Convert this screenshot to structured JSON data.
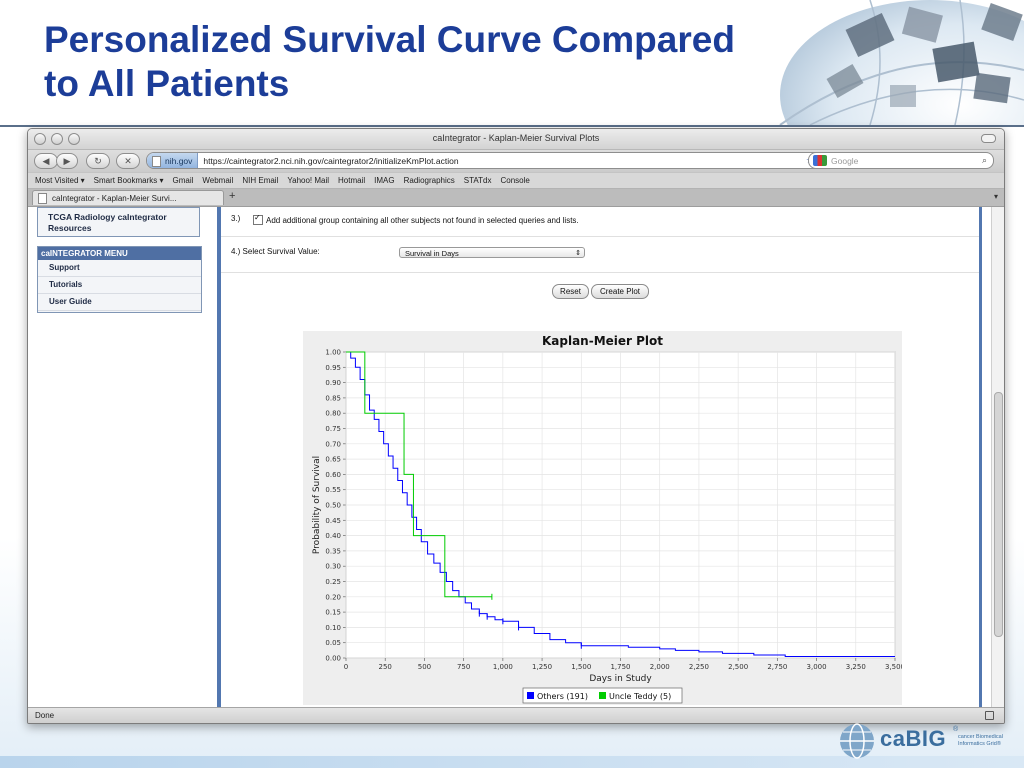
{
  "slide": {
    "title_line1": "Personalized Survival Curve Compared",
    "title_line2": "to All Patients",
    "logo_word": "caBIG",
    "logo_reg": "®",
    "logo_sub": "cancer Biomedical Informatics Grid®"
  },
  "browser": {
    "window_title": "caIntegrator - Kaplan-Meier Survival Plots",
    "site_badge": "nih.gov",
    "url": "https://caintegrator2.nci.nih.gov/caintegrator2/initializeKmPlot.action",
    "search_placeholder": "Google",
    "bookmarks": [
      "Most Visited ▾",
      "Smart Bookmarks ▾",
      "Gmail",
      "Webmail",
      "NIH Email",
      "Yahoo! Mail",
      "Hotmail",
      "IMAG",
      "Radiographics",
      "STATdx",
      "Console"
    ],
    "tab_label": "caIntegrator - Kaplan-Meier Survi...",
    "tab_add": "+",
    "status": "Done"
  },
  "sidebar": {
    "resources_label": "TCGA Radiology caIntegrator Resources",
    "menu_title": "caINTEGRATOR MENU",
    "menu_items": [
      "Support",
      "Tutorials",
      "User Guide"
    ]
  },
  "form": {
    "step3_num": "3.)",
    "step3_text": "Add additional group containing all other subjects not found in selected queries and lists.",
    "step3_checked": true,
    "step4_label": "4.)  Select Survival Value:",
    "survival_value": "Survival in Days",
    "reset_label": "Reset",
    "create_label": "Create Plot"
  },
  "colors": {
    "title_blue": "#1c3d98",
    "others_series": "#0000ff",
    "teddy_series": "#00cc00",
    "menu_header": "#4f6fa3"
  },
  "chart_data": {
    "type": "line",
    "title": "Kaplan-Meier Plot",
    "xlabel": "Days in Study",
    "ylabel": "Probability of Survival",
    "xlim": [
      0,
      3500
    ],
    "ylim": [
      0,
      1
    ],
    "xticks": [
      "0",
      "250",
      "500",
      "750",
      "1,000",
      "1,250",
      "1,500",
      "1,750",
      "2,000",
      "2,250",
      "2,500",
      "2,750",
      "3,000",
      "3,250",
      "3,500"
    ],
    "yticks": [
      "0.00",
      "0.05",
      "0.10",
      "0.15",
      "0.20",
      "0.25",
      "0.30",
      "0.35",
      "0.40",
      "0.45",
      "0.50",
      "0.55",
      "0.60",
      "0.65",
      "0.70",
      "0.75",
      "0.80",
      "0.85",
      "0.90",
      "0.95",
      "1.00"
    ],
    "grid": true,
    "legend_position": "bottom",
    "series": [
      {
        "name": "Others (191)",
        "step": true,
        "x": [
          0,
          30,
          60,
          90,
          120,
          150,
          180,
          210,
          240,
          270,
          300,
          330,
          360,
          390,
          420,
          450,
          480,
          520,
          560,
          600,
          640,
          680,
          720,
          760,
          800,
          850,
          900,
          950,
          1000,
          1100,
          1200,
          1300,
          1400,
          1500,
          1650,
          1800,
          2000,
          2100,
          2250,
          2400,
          2600,
          2800,
          3000,
          3200,
          3500
        ],
        "y": [
          1.0,
          0.98,
          0.95,
          0.91,
          0.86,
          0.81,
          0.78,
          0.74,
          0.7,
          0.66,
          0.62,
          0.58,
          0.54,
          0.5,
          0.46,
          0.42,
          0.38,
          0.34,
          0.31,
          0.28,
          0.25,
          0.22,
          0.2,
          0.18,
          0.16,
          0.145,
          0.135,
          0.125,
          0.12,
          0.1,
          0.08,
          0.06,
          0.05,
          0.04,
          0.04,
          0.035,
          0.03,
          0.025,
          0.02,
          0.015,
          0.01,
          0.005,
          0.005,
          0.005,
          0.005
        ]
      },
      {
        "name": "Uncle Teddy (5)",
        "step": true,
        "x": [
          0,
          120,
          370,
          430,
          630,
          930
        ],
        "y": [
          1.0,
          0.8,
          0.6,
          0.4,
          0.2,
          0.2
        ]
      }
    ],
    "censor_marks": [
      {
        "series": 0,
        "x": [
          850,
          900,
          1000,
          1100,
          1500
        ]
      },
      {
        "series": 1,
        "x": [
          930
        ]
      }
    ]
  }
}
